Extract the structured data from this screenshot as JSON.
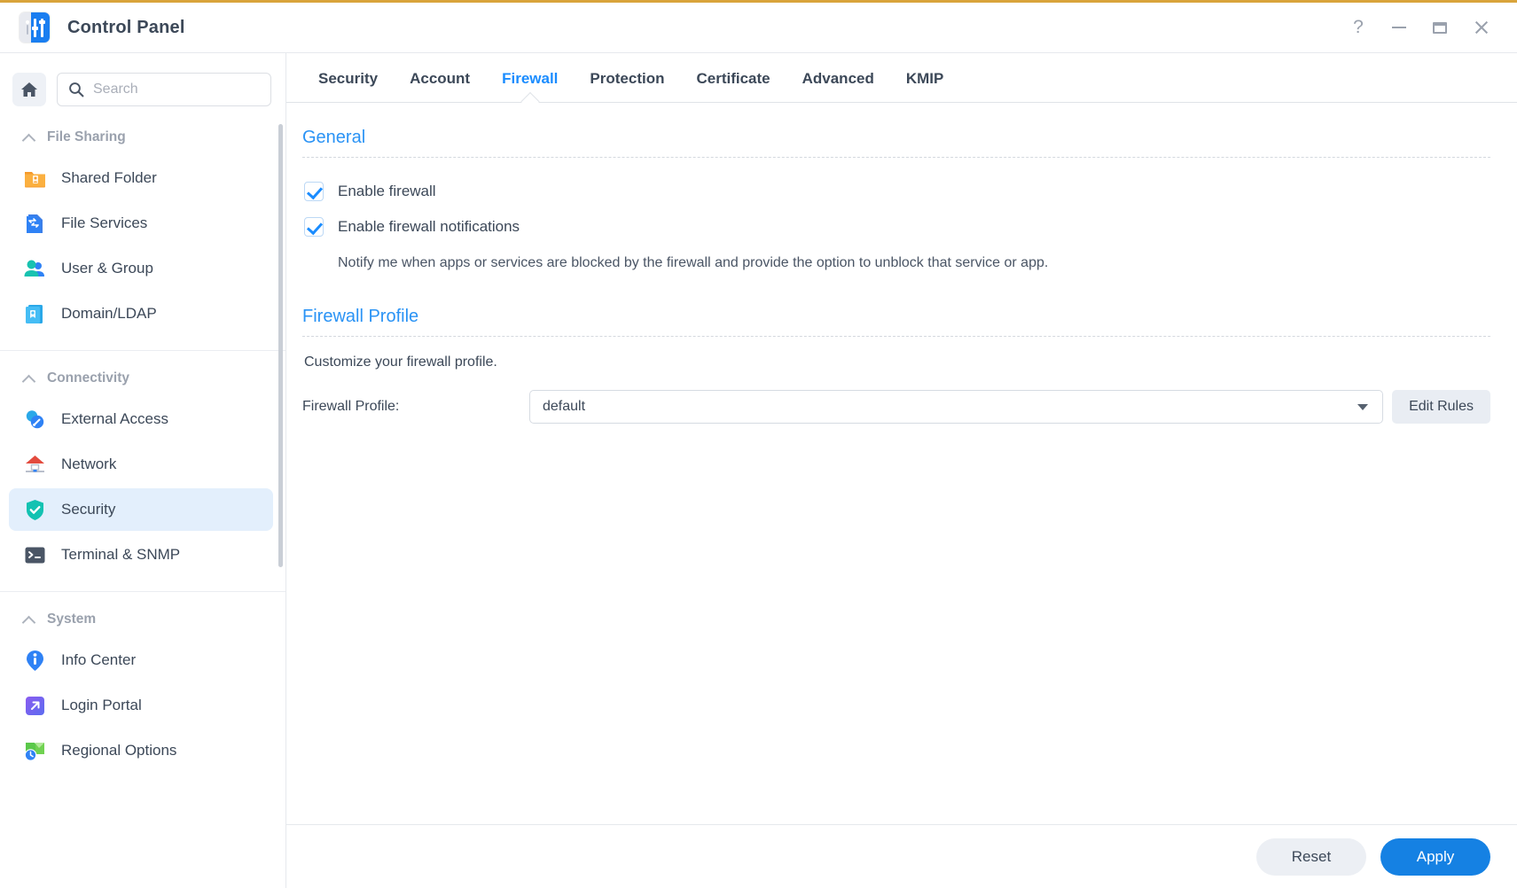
{
  "window": {
    "title": "Control Panel",
    "app_icon": "control-panel-icon",
    "controls": {
      "help": "?",
      "minimize": "minimize-icon",
      "maximize": "maximize-icon",
      "close": "close-icon"
    },
    "accent_top_bar": "#d9a43b"
  },
  "sidebar": {
    "home_icon": "home-icon",
    "search": {
      "icon": "search-icon",
      "placeholder": "Search",
      "value": ""
    },
    "groups": [
      {
        "label": "File Sharing",
        "collapse_icon": "chevron-up-icon",
        "items": [
          {
            "label": "Shared Folder",
            "icon": "shared-folder-icon",
            "active": false
          },
          {
            "label": "File Services",
            "icon": "file-services-icon",
            "active": false
          },
          {
            "label": "User & Group",
            "icon": "user-group-icon",
            "active": false
          },
          {
            "label": "Domain/LDAP",
            "icon": "domain-ldap-icon",
            "active": false
          }
        ]
      },
      {
        "label": "Connectivity",
        "collapse_icon": "chevron-up-icon",
        "items": [
          {
            "label": "External Access",
            "icon": "external-access-icon",
            "active": false
          },
          {
            "label": "Network",
            "icon": "network-icon",
            "active": false
          },
          {
            "label": "Security",
            "icon": "security-shield-icon",
            "active": true
          },
          {
            "label": "Terminal & SNMP",
            "icon": "terminal-snmp-icon",
            "active": false
          }
        ]
      },
      {
        "label": "System",
        "collapse_icon": "chevron-up-icon",
        "items": [
          {
            "label": "Info Center",
            "icon": "info-center-icon",
            "active": false
          },
          {
            "label": "Login Portal",
            "icon": "login-portal-icon",
            "active": false
          },
          {
            "label": "Regional Options",
            "icon": "regional-options-icon",
            "active": false
          }
        ]
      }
    ]
  },
  "tabs": [
    {
      "label": "Security",
      "active": false
    },
    {
      "label": "Account",
      "active": false
    },
    {
      "label": "Firewall",
      "active": true
    },
    {
      "label": "Protection",
      "active": false
    },
    {
      "label": "Certificate",
      "active": false
    },
    {
      "label": "Advanced",
      "active": false
    },
    {
      "label": "KMIP",
      "active": false
    }
  ],
  "main": {
    "general": {
      "title": "General",
      "enable_firewall": {
        "label": "Enable firewall",
        "checked": true
      },
      "enable_notifications": {
        "label": "Enable firewall notifications",
        "checked": true
      },
      "notifications_help": "Notify me when apps or services are blocked by the firewall and provide the option to unblock that service or app."
    },
    "firewall_profile": {
      "title": "Firewall Profile",
      "description": "Customize your firewall profile.",
      "field_label": "Firewall Profile:",
      "selected_value": "default",
      "dropdown_icon": "chevron-down-icon",
      "edit_rules_label": "Edit Rules"
    }
  },
  "footer": {
    "reset_label": "Reset",
    "apply_label": "Apply"
  },
  "colors": {
    "accent_blue": "#1a8cff",
    "section_heading": "#2a93f5",
    "apply_button": "#1581e3",
    "active_item_bg": "#e3effc",
    "top_bar": "#d9a43b"
  }
}
